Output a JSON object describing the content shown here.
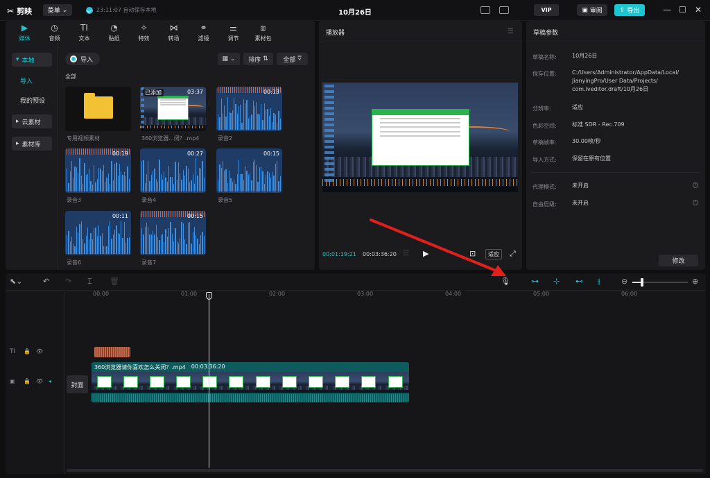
{
  "app": {
    "menu_label": "菜单",
    "save_status": "23:11:07 自动保存本地",
    "title": "10月26日",
    "vip": "VIP",
    "review": "审阅",
    "export": "导出"
  },
  "media": {
    "tabs": [
      {
        "label": "媒体",
        "icon": "media-icon"
      },
      {
        "label": "音频",
        "icon": "audio-icon"
      },
      {
        "label": "文本",
        "icon": "text-icon"
      },
      {
        "label": "贴纸",
        "icon": "sticker-icon"
      },
      {
        "label": "特效",
        "icon": "effects-icon"
      },
      {
        "label": "转场",
        "icon": "transition-icon"
      },
      {
        "label": "滤镜",
        "icon": "filter-icon"
      },
      {
        "label": "调节",
        "icon": "adjust-icon"
      },
      {
        "label": "素材包",
        "icon": "package-icon"
      }
    ],
    "sidebar": {
      "local": "本地",
      "import": "导入",
      "presets": "我的预设",
      "cloud": "云素材",
      "library": "素材库"
    },
    "import_label": "导入",
    "sort_label": "排序",
    "filter_label": "全部",
    "section": "全部",
    "items": [
      {
        "label": "专用视频素材",
        "duration": ""
      },
      {
        "label": "360浏览器...闭？.mp4",
        "duration": "03:37",
        "badge": "已添加"
      },
      {
        "label": "录音2",
        "duration": "00:13"
      },
      {
        "label": "录音3",
        "duration": "00:19"
      },
      {
        "label": "录音4",
        "duration": "00:27"
      },
      {
        "label": "录音5",
        "duration": "00:15"
      },
      {
        "label": "录音6",
        "duration": "00:11"
      },
      {
        "label": "录音7",
        "duration": "00:15"
      }
    ]
  },
  "player": {
    "title": "播放器",
    "current_time": "00:01:19:21",
    "total_time": "00:03:36:20",
    "fit_label": "适应"
  },
  "props": {
    "title": "草稿参数",
    "rows": [
      {
        "label": "草稿名称:",
        "value": "10月26日"
      },
      {
        "label": "保存位置:",
        "value": "C:/Users/Administrator/AppData/Local/ JianyingPro/User Data/Projects/ com.lveditor.draft/10月26日"
      },
      {
        "label": "分辨率:",
        "value": "适应"
      },
      {
        "label": "色彩空间:",
        "value": "标准 SDR - Rec.709"
      },
      {
        "label": "草稿帧率:",
        "value": "30.00帧/秒"
      },
      {
        "label": "导入方式:",
        "value": "保留在原有位置"
      },
      {
        "label": "代理模式:",
        "value": "未开启"
      },
      {
        "label": "自由层级:",
        "value": "未开启"
      }
    ],
    "modify": "修改"
  },
  "timeline": {
    "ticks": [
      "00:00",
      "01:00",
      "02:00",
      "03:00",
      "04:00",
      "05:00",
      "06:00"
    ],
    "clip_name": "360浏览器请你喜欢怎么关闭？.mp4",
    "clip_duration": "00:03:36:20",
    "cover_label": "封面",
    "text_track_label": "TI"
  },
  "colors": {
    "accent": "#1ec5cf",
    "clip": "#0f5a5c",
    "annotation_arrow": "#e0201c"
  }
}
